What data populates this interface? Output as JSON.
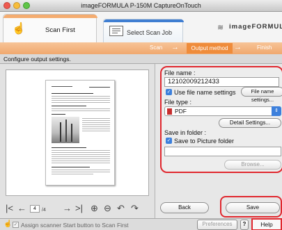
{
  "window": {
    "title": "imageFORMULA P-150M CaptureOnTouch"
  },
  "tabs": [
    {
      "label": "Scan First"
    },
    {
      "label": "Select Scan Job"
    }
  ],
  "brand": "imageFORMUL",
  "steps": [
    {
      "label": "Scan"
    },
    {
      "label": "Output method"
    },
    {
      "label": "Finish"
    }
  ],
  "instruction": "Configure output settings.",
  "form": {
    "file_name_label": "File name :",
    "file_name_value": "12102009212433",
    "use_file_name_settings": "Use file name settings",
    "file_name_settings_button": "File name settings...",
    "file_type_label": "File type :",
    "file_type_value": "PDF",
    "detail_settings_button": "Detail Settings...",
    "save_in_folder_label": "Save in folder :",
    "save_to_picture_folder": "Save to Picture folder",
    "browse_button": "Browse..."
  },
  "pagination": {
    "current": "4",
    "total": "/4"
  },
  "buttons": {
    "back": "Back",
    "save": "Save"
  },
  "footer": {
    "assign_scanner": "Assign scanner Start button to Scan First",
    "preferences": "Preferences",
    "help_icon": "?",
    "help": "Help"
  },
  "colors": {
    "accent": "#ef8c3b",
    "highlight": "#e0262d",
    "checkbox": "#3d80dc"
  }
}
